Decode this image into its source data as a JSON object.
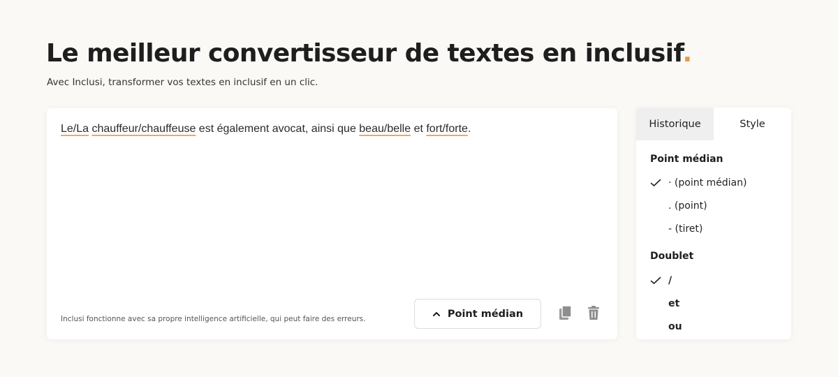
{
  "header": {
    "title": "Le meilleur convertisseur de textes en inclusif",
    "title_punct": ".",
    "subtitle": "Avec Inclusi, transformer vos textes en inclusif en un clic."
  },
  "editor": {
    "segments": [
      {
        "text": "Le/La",
        "highlight": true
      },
      {
        "text": " ",
        "highlight": false
      },
      {
        "text": "chauffeur/chauffeuse",
        "highlight": true
      },
      {
        "text": " est également avocat, ainsi que ",
        "highlight": false
      },
      {
        "text": "beau/belle",
        "highlight": true
      },
      {
        "text": " et ",
        "highlight": false
      },
      {
        "text": "fort/forte",
        "highlight": true
      },
      {
        "text": ".",
        "highlight": false
      }
    ],
    "disclaimer": "Inclusi fonctionne avec sa propre intelligence artificielle, qui peut faire des erreurs.",
    "style_button_label": "Point médian",
    "copy_icon": "copy-icon",
    "delete_icon": "trash-icon"
  },
  "panel": {
    "tabs": [
      {
        "label": "Historique",
        "active": false
      },
      {
        "label": "Style",
        "active": true
      }
    ],
    "sections": [
      {
        "title": "Point médian",
        "options": [
          {
            "label": "· (point médian)",
            "selected": true,
            "bold": false
          },
          {
            "label": ". (point)",
            "selected": false,
            "bold": false
          },
          {
            "label": "- (tiret)",
            "selected": false,
            "bold": false
          }
        ]
      },
      {
        "title": "Doublet",
        "options": [
          {
            "label": "/",
            "selected": true,
            "bold": true
          },
          {
            "label": "et",
            "selected": false,
            "bold": true
          },
          {
            "label": "ou",
            "selected": false,
            "bold": true
          }
        ]
      }
    ]
  },
  "colors": {
    "background": "#fbf9f6",
    "highlight_underline": "#f0a85a",
    "accent_dot": "#e39a4b",
    "icon_gray": "#8e8e8e"
  }
}
